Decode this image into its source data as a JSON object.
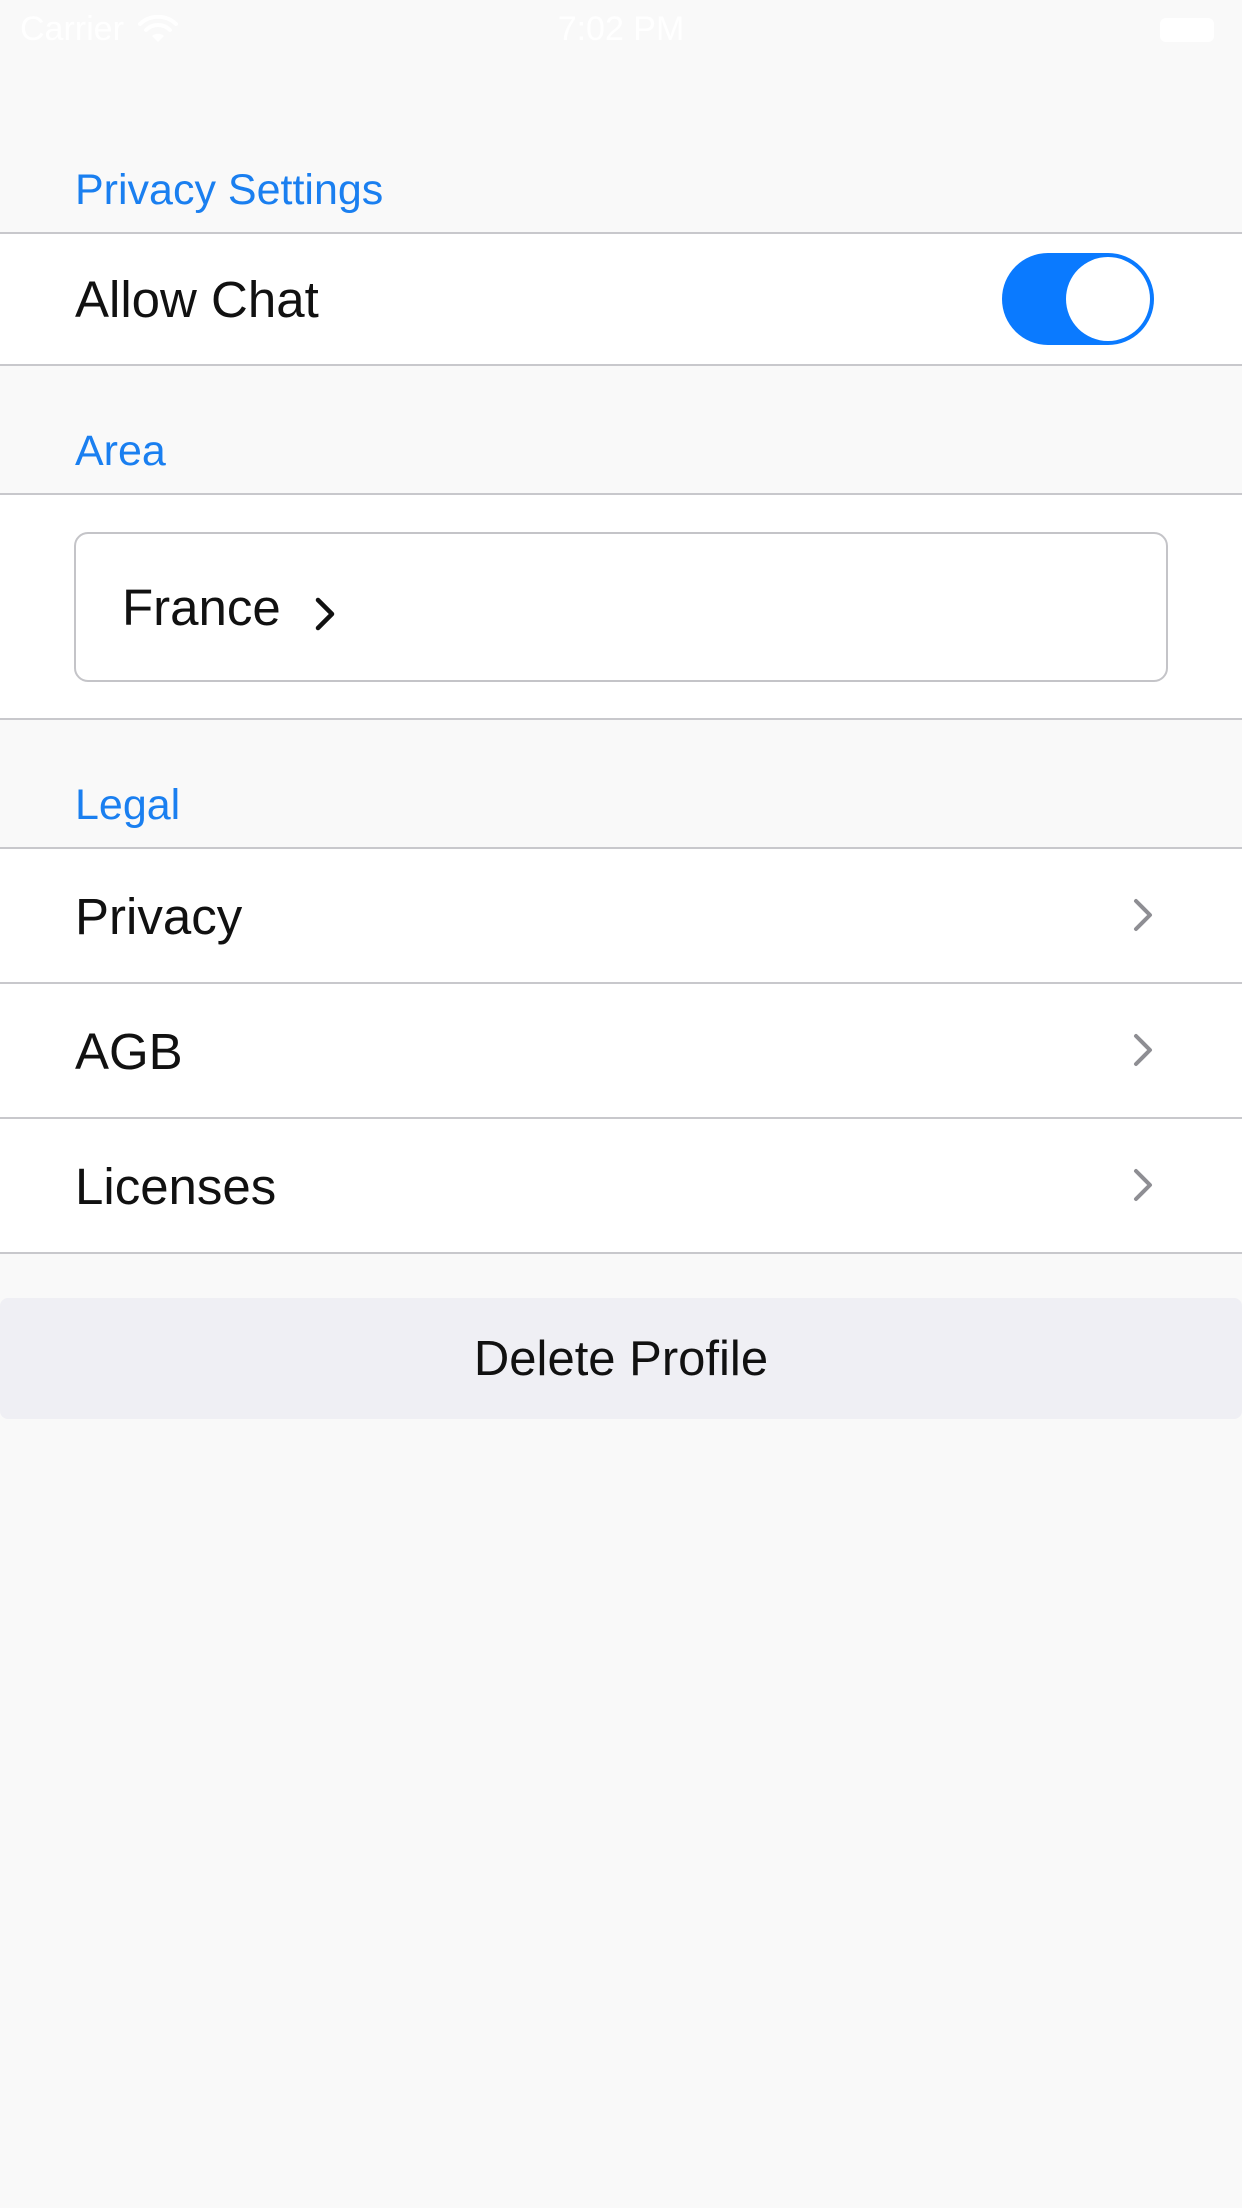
{
  "status_bar": {
    "carrier": "Carrier",
    "time": "7:02 PM",
    "wifi_icon": "wifi-icon",
    "battery_icon": "battery-icon"
  },
  "privacy_section": {
    "header": "Privacy Settings",
    "allow_chat": {
      "label": "Allow Chat",
      "enabled": true
    }
  },
  "area_section": {
    "header": "Area",
    "selected_value": "France",
    "chevron_icon": "chevron-right-icon"
  },
  "legal_section": {
    "header": "Legal",
    "items": [
      {
        "label": "Privacy",
        "icon": "chevron-right-icon"
      },
      {
        "label": "AGB",
        "icon": "chevron-right-icon"
      },
      {
        "label": "Licenses",
        "icon": "chevron-right-icon"
      }
    ]
  },
  "delete_profile": {
    "label": "Delete Profile"
  },
  "colors": {
    "accent": "#1a7ff0",
    "toggle_on": "#0a7aff",
    "background": "#f9f9f9",
    "button_background": "#efeff4",
    "separator": "#c8c8cc"
  }
}
